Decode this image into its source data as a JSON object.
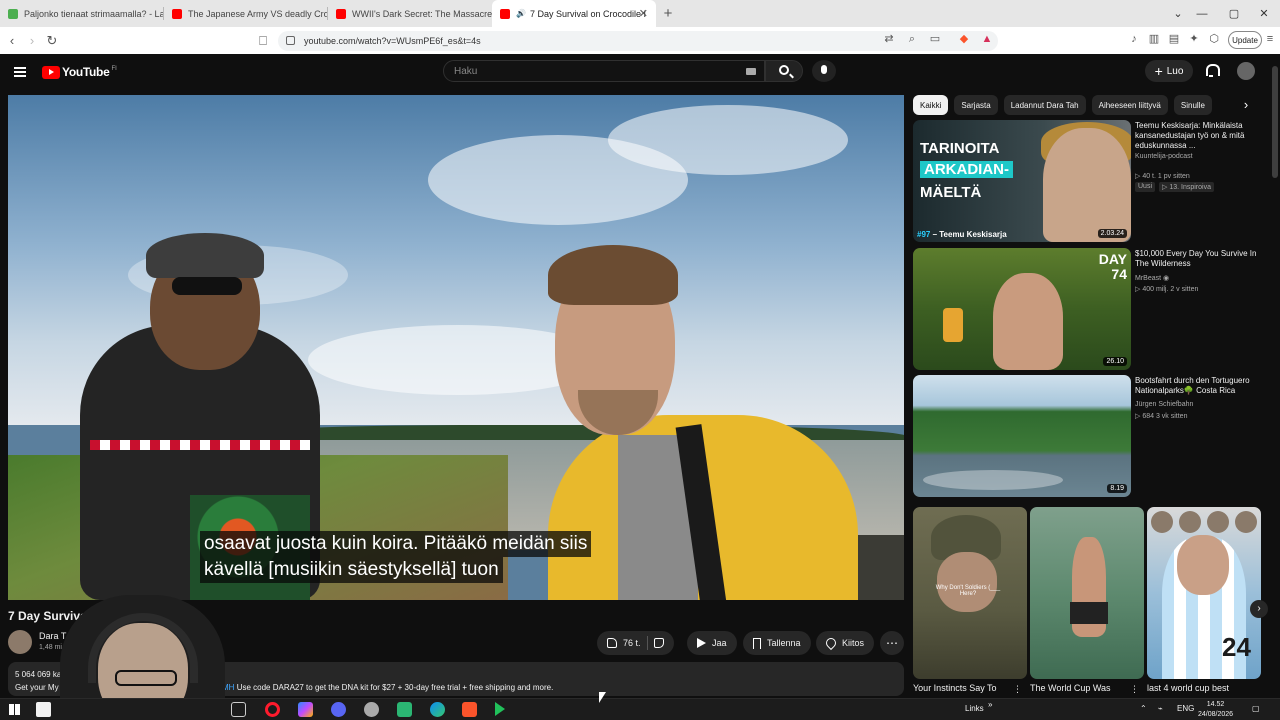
{
  "browser": {
    "tabs": [
      {
        "title": "Paljonko tienaat strimaamalla? - Las",
        "favicon_color": "#4caf50"
      },
      {
        "title": "The Japanese Army VS deadly Crocod",
        "favicon_color": "#ff0000"
      },
      {
        "title": "WWII's Dark Secret: The Massacre of",
        "favicon_color": "#ff0000"
      },
      {
        "title": "7 Day Survival on Crocodile I",
        "favicon_color": "#ff0000",
        "active": true
      }
    ],
    "url": "youtube.com/watch?v=WUsmPE6f_es&t=4s",
    "update_label": "Update"
  },
  "masthead": {
    "logo_text": "YouTube",
    "country_code": "FI",
    "search_placeholder": "Haku",
    "create_label": "Luo"
  },
  "player": {
    "subtitle_lines": [
      "osaavat juosta kuin koira.  Pitääkö meidän siis",
      "kävellä [musiikin säestyksellä] tuon"
    ]
  },
  "video": {
    "title": "7 Day Survival on Croc",
    "channel": "Dara T",
    "subscribers": "1,48 mi",
    "like_count": "76 t.",
    "share_label": "Jaa",
    "save_label": "Tallenna",
    "thanks_label": "Kiitos",
    "desc_stats": "5 064 069 ka",
    "desc_text": "Get your My",
    "desc_link": "MH",
    "desc_line": "Use code DARA27 to get the DNA kit for $27 + 30-day free trial + free shipping and more."
  },
  "chips": [
    "Kaikki",
    "Sarjasta",
    "Ladannut Dara Tah",
    "Aiheeseen liittyvä",
    "Sinulle"
  ],
  "recommendations": [
    {
      "title": "Teemu Keskisarja: Minkälaista kansanedustajan työ on & mitä eduskunnassa ...",
      "channel": "Kuuntelija-podcast",
      "meta": "▷ 40 t.  1 pv sitten",
      "badges": [
        "Uusi",
        "▷ 13. Inspiroiva"
      ],
      "duration": "2.03.24",
      "thumb_lines": [
        "TARINOITA",
        "ARKADIAN-",
        "MÄELTÄ"
      ],
      "episode_number": "#97",
      "episode_host": " – Teemu Keskisarja"
    },
    {
      "title": "$10,000 Every Day You Survive In The Wilderness",
      "channel": "MrBeast ◉",
      "meta": "▷ 400 milj.  2 v sitten",
      "duration": "26.10",
      "thumb_text": "DAY 74"
    },
    {
      "title": "Bootsfahrt durch den Tortuguero Nationalparks🌳 Costa Rica",
      "channel": "Jürgen Schiefbahn",
      "meta": "▷ 684  3 vk sitten",
      "duration": "8.19"
    }
  ],
  "shorts": [
    {
      "title": "Your Instincts Say To",
      "caption": "Why Don't Soldiers (___ Here?"
    },
    {
      "title": "The World Cup Was"
    },
    {
      "title": "last 4 world cup best",
      "number": "24"
    }
  ],
  "taskbar": {
    "links_label": "Links",
    "lang": "ENG",
    "time": "14.52",
    "date": "24/08/2026"
  }
}
